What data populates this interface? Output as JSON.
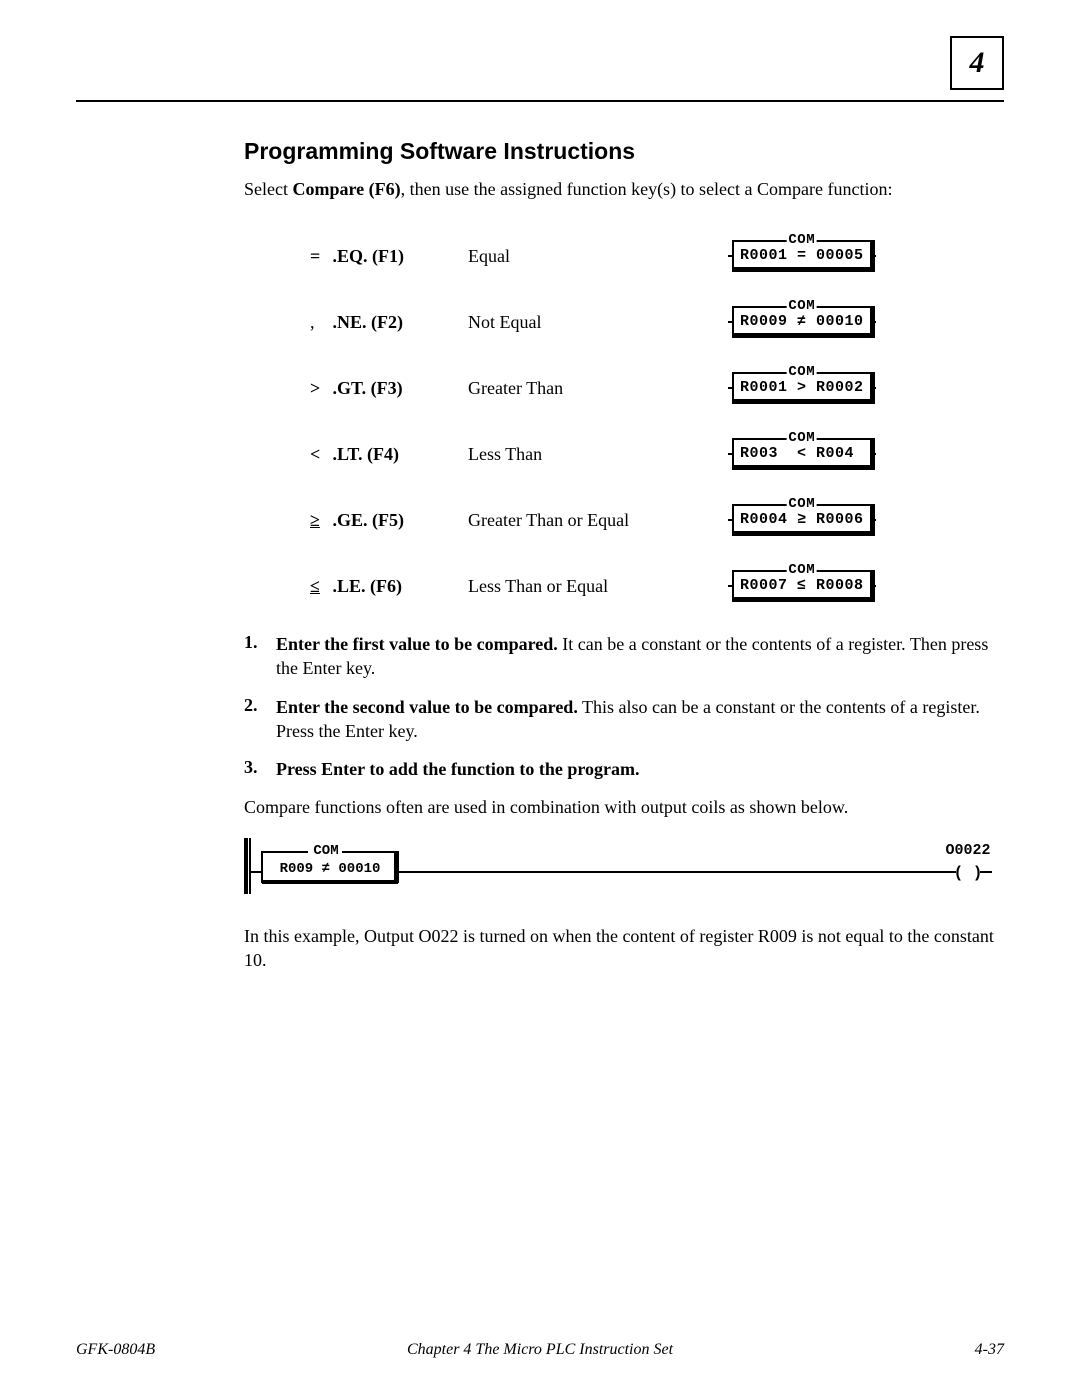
{
  "chapter_badge": "4",
  "section_heading": "Programming Software Instructions",
  "intro_prefix": "Select ",
  "intro_bold": "Compare (F6)",
  "intro_suffix": ", then use the assigned function key(s) to select a Compare function:",
  "functions": [
    {
      "prefix": "=",
      "key": ".EQ. (F1)",
      "desc": "Equal",
      "block_label": "COM",
      "block_text": "R0001 = 00005"
    },
    {
      "prefix": ",",
      "key": ".NE. (F2)",
      "desc": "Not Equal",
      "block_label": "COM",
      "block_text": "R0009 ≠ 00010"
    },
    {
      "prefix": ">",
      "key": ".GT. (F3)",
      "desc": "Greater Than",
      "block_label": "COM",
      "block_text": "R0001 > R0002"
    },
    {
      "prefix": "<",
      "key": ".LT. (F4)",
      "desc": "Less Than",
      "block_label": "COM",
      "block_text": "R003  < R004 "
    },
    {
      "prefix": "≥",
      "key": ".GE. (F5)",
      "desc": "Greater Than or Equal",
      "block_label": "COM",
      "block_text": "R0004 ≥ R0006"
    },
    {
      "prefix": "≤",
      "key": ".LE. (F6)",
      "desc": "Less Than or Equal",
      "block_label": "COM",
      "block_text": "R0007 ≤ R0008"
    }
  ],
  "steps": [
    {
      "num": "1.",
      "bold": "Enter the first value to be compared.",
      "rest": " It can be a constant or the contents of a register.  Then press the Enter key."
    },
    {
      "num": "2.",
      "bold": "Enter the second value to be compared.",
      "rest": " This also can be a constant or the contents of a register. Press the Enter key."
    },
    {
      "num": "3.",
      "bold": "Press Enter to add the function to the program.",
      "rest": ""
    }
  ],
  "para_after_steps": "Compare functions often are used in combination with output coils as shown below.",
  "example": {
    "block_label": "COM",
    "block_text": "R009  ≠ 00010",
    "output_label": "O0022",
    "coil_symbol": "( )"
  },
  "para_example": "In this example, Output O022 is turned on when the content of register R009 is not equal to the constant 10.",
  "footer": {
    "left": "GFK-0804B",
    "center": "Chapter 4   The Micro PLC Instruction Set",
    "right": "4-37"
  }
}
